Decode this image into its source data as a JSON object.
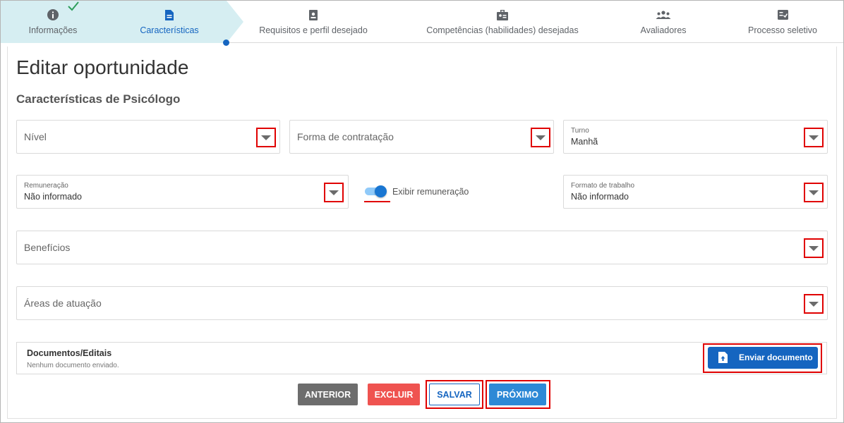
{
  "stepper": {
    "steps": [
      {
        "label": "Informações",
        "icon": "info-icon"
      },
      {
        "label": "Características",
        "icon": "document-icon"
      },
      {
        "label": "Requisitos e perfil desejado",
        "icon": "badge-icon"
      },
      {
        "label": "Competências (habilidades) desejadas",
        "icon": "id-card-icon"
      },
      {
        "label": "Avaliadores",
        "icon": "group-icon"
      },
      {
        "label": "Processo seletivo",
        "icon": "checklist-icon"
      }
    ],
    "active_color": "#1565c0",
    "active_bg": "#d6eef2"
  },
  "page": {
    "title": "Editar oportunidade",
    "subtitle": "Características de Psicólogo"
  },
  "form": {
    "nivel": {
      "placeholder": "Nível"
    },
    "forma": {
      "placeholder": "Forma de contratação"
    },
    "turno": {
      "label": "Turno",
      "value": "Manhã"
    },
    "remuneracao": {
      "label": "Remuneração",
      "value": "Não informado"
    },
    "exibir": {
      "label": "Exibir remuneração",
      "checked": true
    },
    "formato": {
      "label": "Formato de trabalho",
      "value": "Não informado"
    },
    "beneficios": {
      "placeholder": "Benefícios"
    },
    "areas": {
      "placeholder": "Áreas de atuação"
    }
  },
  "documents": {
    "title": "Documentos/Editais",
    "note": "Nenhum documento enviado.",
    "send_label": "Enviar documento"
  },
  "actions": {
    "anterior": "ANTERIOR",
    "excluir": "EXCLUIR",
    "salvar": "SALVAR",
    "proximo": "PRÓXIMO"
  },
  "colors": {
    "highlight": "#e00000",
    "primary": "#1565c0",
    "danger": "#ef5350",
    "secondary": "#6d6d6d"
  }
}
